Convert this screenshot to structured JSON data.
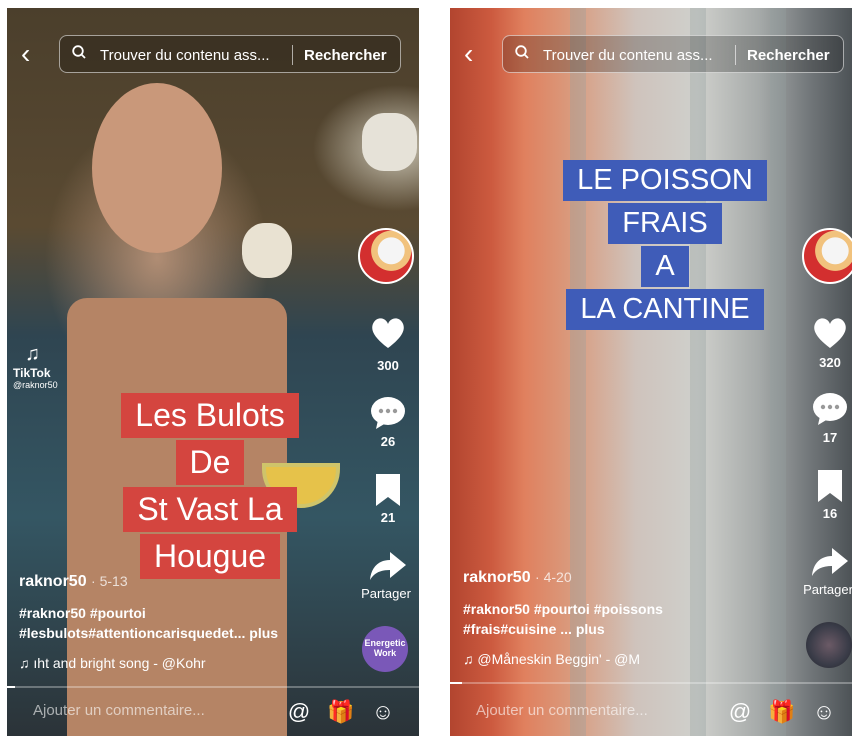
{
  "colors": {
    "caption_red": "#d4453f",
    "caption_blue": "#3f5cb8",
    "like_white": "#ffffff",
    "accent_pink": "#fe2c55"
  },
  "search": {
    "placeholder_1": "Trouver du contenu ass...",
    "placeholder_2": "Trouver du contenu ass...",
    "button": "Rechercher"
  },
  "video1": {
    "caption_lines": [
      "Les Bulots",
      "De",
      "St Vast La",
      "Hougue"
    ],
    "likes": "300",
    "comments": "26",
    "saves": "21",
    "share": "Partager",
    "username": "raknor50",
    "date": "· 5-13",
    "hashtags_line1": "#raknor50 #pourtoi",
    "hashtags_line2": "#lesbulots#attentioncarisquedet...",
    "more": "plus",
    "music": "♫ ıht and bright song - @Kohr",
    "watermark_brand": "TikTok",
    "watermark_user": "@raknor50",
    "disc_text": "Energetic Work",
    "comment_placeholder": "Ajouter un commentaire..."
  },
  "video2": {
    "caption_lines": [
      "LE POISSON",
      "FRAIS",
      "A",
      "LA CANTINE"
    ],
    "likes": "320",
    "comments": "17",
    "saves": "16",
    "share": "Partager",
    "username": "raknor50",
    "date": "· 4-20",
    "hashtags_line1": "#raknor50 #pourtoi #poissons",
    "hashtags_line2": "#frais#cuisine ...",
    "more": "plus",
    "music": "♫ @Måneskin   Beggin' - @M",
    "comment_placeholder": "Ajouter un commentaire..."
  },
  "icons": [
    "back-icon",
    "search-icon",
    "heart-icon",
    "comment-icon",
    "bookmark-icon",
    "share-icon",
    "mention-icon",
    "gift-icon",
    "emoji-icon",
    "music-note-icon"
  ],
  "progress": {
    "video1": 0.02,
    "video2": 0.03
  }
}
